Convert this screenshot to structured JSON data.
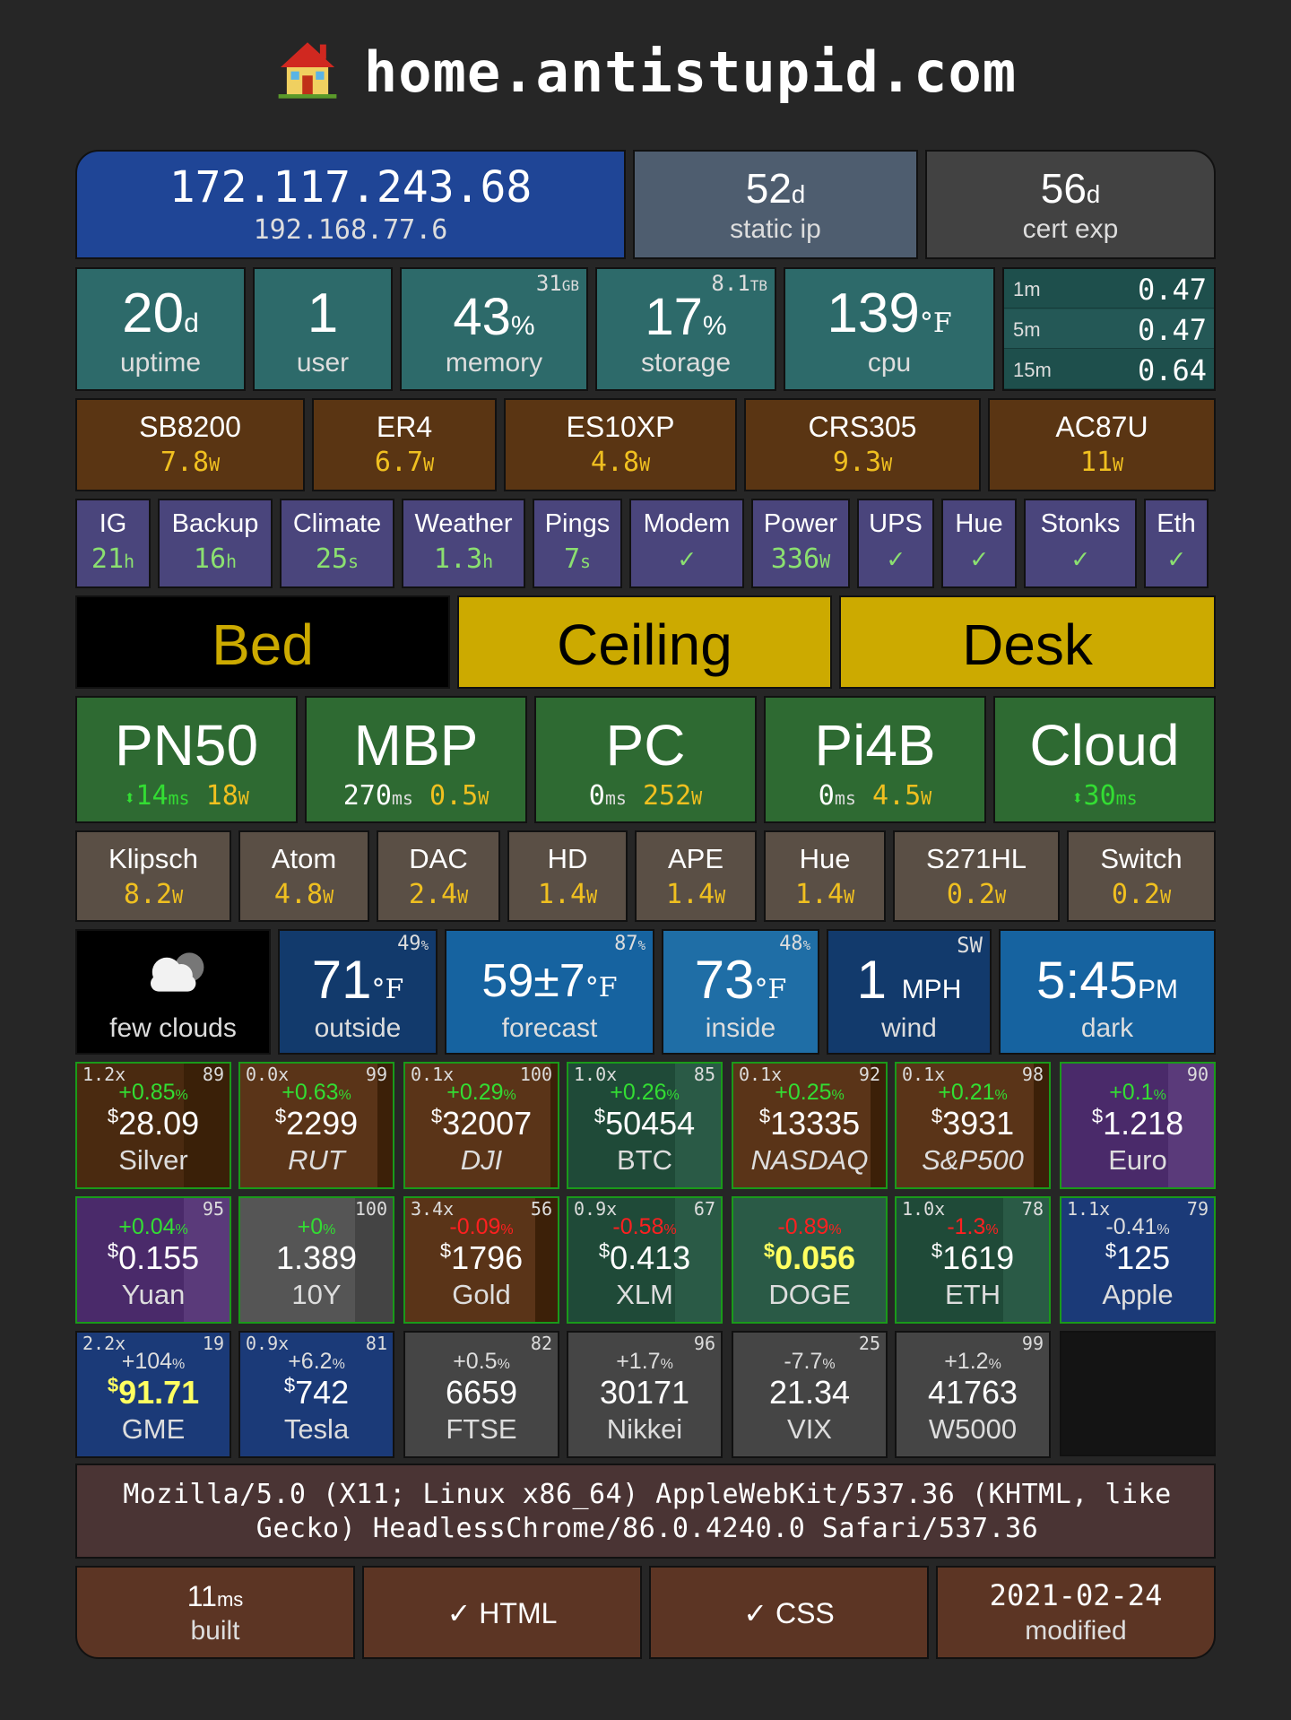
{
  "header": {
    "title": "home.antistupid.com",
    "icon": "house-icon"
  },
  "network": {
    "public_ip": "172.117.243.68",
    "local_ip": "192.168.77.6",
    "static_ip": {
      "value": "52",
      "unit": "d",
      "label": "static ip"
    },
    "cert": {
      "value": "56",
      "unit": "d",
      "label": "cert exp"
    }
  },
  "system": {
    "uptime": {
      "value": "20",
      "unit": "d",
      "label": "uptime"
    },
    "users": {
      "value": "1",
      "label": "user"
    },
    "memory": {
      "value": "43",
      "unit": "%",
      "label": "memory",
      "total": "31",
      "total_unit": "GB"
    },
    "storage": {
      "value": "17",
      "unit": "%",
      "label": "storage",
      "total": "8.1",
      "total_unit": "TB"
    },
    "cpu": {
      "value": "139",
      "unit": "°F",
      "label": "cpu"
    },
    "load": [
      {
        "period": "1m",
        "value": "0.47"
      },
      {
        "period": "5m",
        "value": "0.47"
      },
      {
        "period": "15m",
        "value": "0.64"
      }
    ]
  },
  "devices_power": [
    {
      "name": "SB8200",
      "value": "7.8",
      "unit": "W"
    },
    {
      "name": "ER4",
      "value": "6.7",
      "unit": "W"
    },
    {
      "name": "ES10XP",
      "value": "4.8",
      "unit": "W"
    },
    {
      "name": "CRS305",
      "value": "9.3",
      "unit": "W"
    },
    {
      "name": "AC87U",
      "value": "11",
      "unit": "W"
    }
  ],
  "services": [
    {
      "name": "IG",
      "value": "21",
      "unit": "h"
    },
    {
      "name": "Backup",
      "value": "16",
      "unit": "h"
    },
    {
      "name": "Climate",
      "value": "25",
      "unit": "s"
    },
    {
      "name": "Weather",
      "value": "1.3",
      "unit": "h"
    },
    {
      "name": "Pings",
      "value": "7",
      "unit": "s"
    },
    {
      "name": "Modem",
      "value": "✓",
      "unit": ""
    },
    {
      "name": "Power",
      "value": "336",
      "unit": "W"
    },
    {
      "name": "UPS",
      "value": "✓",
      "unit": ""
    },
    {
      "name": "Hue",
      "value": "✓",
      "unit": ""
    },
    {
      "name": "Stonks",
      "value": "✓",
      "unit": ""
    },
    {
      "name": "Eth",
      "value": "✓",
      "unit": ""
    }
  ],
  "lights": [
    {
      "name": "Bed",
      "state": "off"
    },
    {
      "name": "Ceiling",
      "state": "on"
    },
    {
      "name": "Desk",
      "state": "on"
    }
  ],
  "hosts": [
    {
      "name": "PN50",
      "arrow": "⬍",
      "ping": "14",
      "ping_unit": "ms",
      "power": "18",
      "power_unit": "W"
    },
    {
      "name": "MBP",
      "arrow": "",
      "ping": "270",
      "ping_unit": "ms",
      "power": "0.5",
      "power_unit": "W"
    },
    {
      "name": "PC",
      "arrow": "",
      "ping": "0",
      "ping_unit": "ms",
      "power": "252",
      "power_unit": "W"
    },
    {
      "name": "Pi4B",
      "arrow": "",
      "ping": "0",
      "ping_unit": "ms",
      "power": "4.5",
      "power_unit": "W"
    },
    {
      "name": "Cloud",
      "arrow": "⬍",
      "ping": "30",
      "ping_unit": "ms",
      "power": "",
      "power_unit": ""
    }
  ],
  "outlets": [
    {
      "name": "Klipsch",
      "value": "8.2",
      "unit": "W"
    },
    {
      "name": "Atom",
      "value": "4.8",
      "unit": "W"
    },
    {
      "name": "DAC",
      "value": "2.4",
      "unit": "W"
    },
    {
      "name": "HD",
      "value": "1.4",
      "unit": "W"
    },
    {
      "name": "APE",
      "value": "1.4",
      "unit": "W"
    },
    {
      "name": "Hue",
      "value": "1.4",
      "unit": "W"
    },
    {
      "name": "S271HL",
      "value": "0.2",
      "unit": "W"
    },
    {
      "name": "Switch",
      "value": "0.2",
      "unit": "W"
    }
  ],
  "weather": {
    "condition": "few clouds",
    "icon": "cloud-icon",
    "outside": {
      "value": "71",
      "unit": "°F",
      "label": "outside",
      "humidity": "49",
      "humidity_unit": "%"
    },
    "forecast": {
      "value": "59±7",
      "unit": "°F",
      "label": "forecast",
      "humidity": "87",
      "humidity_unit": "%"
    },
    "inside": {
      "value": "73",
      "unit": "°F",
      "label": "inside",
      "humidity": "48",
      "humidity_unit": "%"
    },
    "wind": {
      "value": "1",
      "unit": "MPH",
      "label": "wind",
      "direction": "SW"
    },
    "time": {
      "value": "5:45",
      "unit": "PM",
      "label": "dark"
    }
  },
  "stocks": [
    {
      "mult": "1.2x",
      "rank": "89",
      "change": "+0.85",
      "currency": "$",
      "price": "28.09",
      "name": "Silver",
      "italic": false,
      "dir": "up",
      "bg": "#4a2a10",
      "bar": "#3a2008",
      "bar_frac": 0.3
    },
    {
      "mult": "0.0x",
      "rank": "99",
      "change": "+0.63",
      "currency": "$",
      "price": "2299",
      "name": "RUT",
      "italic": true,
      "dir": "up",
      "bg": "#5a3418",
      "bar": "#3c2008",
      "bar_frac": 0.1
    },
    {
      "mult": "0.1x",
      "rank": "100",
      "change": "+0.29",
      "currency": "$",
      "price": "32007",
      "name": "DJI",
      "italic": true,
      "dir": "up",
      "bg": "#5a3418",
      "bar": "#3c2008",
      "bar_frac": 0.05
    },
    {
      "mult": "1.0x",
      "rank": "85",
      "change": "+0.26",
      "currency": "$",
      "price": "50454",
      "name": "BTC",
      "italic": false,
      "dir": "up",
      "bg": "#1f4a38",
      "bar": "#2a5a46",
      "bar_frac": 0.3
    },
    {
      "mult": "0.1x",
      "rank": "92",
      "change": "+0.25",
      "currency": "$",
      "price": "13335",
      "name": "NASDAQ",
      "italic": true,
      "dir": "up",
      "bg": "#5a3418",
      "bar": "#3c2008",
      "bar_frac": 0.1
    },
    {
      "mult": "0.1x",
      "rank": "98",
      "change": "+0.21",
      "currency": "$",
      "price": "3931",
      "name": "S&P500",
      "italic": true,
      "dir": "up",
      "bg": "#5a3418",
      "bar": "#3c2008",
      "bar_frac": 0.1
    },
    {
      "mult": "",
      "rank": "90",
      "change": "+0.1",
      "currency": "$",
      "price": "1.218",
      "name": "Euro",
      "italic": false,
      "dir": "up",
      "bg": "#4a2a6a",
      "bar": "#5a3a7a",
      "bar_frac": 0.3
    },
    {
      "mult": "",
      "rank": "95",
      "change": "+0.04",
      "currency": "$",
      "price": "0.155",
      "name": "Yuan",
      "italic": false,
      "dir": "up",
      "bg": "#4a2a6a",
      "bar": "#5a3a7a",
      "bar_frac": 0.3
    },
    {
      "mult": "",
      "rank": "100",
      "change": "+0",
      "currency": "",
      "price": "1.389",
      "name": "10Y",
      "italic": false,
      "dir": "up",
      "bg": "#555",
      "bar": "#444",
      "bar_frac": 0.25
    },
    {
      "mult": "3.4x",
      "rank": "56",
      "change": "-0.09",
      "currency": "$",
      "price": "1796",
      "name": "Gold",
      "italic": false,
      "dir": "down",
      "bg": "#5a3418",
      "bar": "#3c2008",
      "bar_frac": 0.15
    },
    {
      "mult": "0.9x",
      "rank": "67",
      "change": "-0.58",
      "currency": "$",
      "price": "0.413",
      "name": "XLM",
      "italic": false,
      "dir": "down",
      "bg": "#1f4a38",
      "bar": "#2a5a46",
      "bar_frac": 0.3
    },
    {
      "mult": "",
      "rank": "",
      "change": "-0.89",
      "currency": "$",
      "price": "0.056",
      "name": "DOGE",
      "italic": false,
      "dir": "down",
      "bg": "#2a5a46",
      "bar": "#2a5a46",
      "bar_frac": 0.0,
      "highlight": true
    },
    {
      "mult": "1.0x",
      "rank": "78",
      "change": "-1.3",
      "currency": "$",
      "price": "1619",
      "name": "ETH",
      "italic": false,
      "dir": "down",
      "bg": "#1f4a38",
      "bar": "#2a5a46",
      "bar_frac": 0.3
    },
    {
      "mult": "1.1x",
      "rank": "79",
      "change": "-0.41",
      "currency": "$",
      "price": "125",
      "name": "Apple",
      "italic": false,
      "dir": "flat",
      "bg": "#1b3a78",
      "bar": "#1b3a78",
      "bar_frac": 0.0
    },
    {
      "mult": "2.2x",
      "rank": "19",
      "change": "+104",
      "currency": "$",
      "price": "91.71",
      "name": "GME",
      "italic": false,
      "dir": "flat",
      "bg": "#1b3a78",
      "bar": "#1b3a78",
      "bar_frac": 0.0,
      "highlight": true,
      "nogreen": true
    },
    {
      "mult": "0.9x",
      "rank": "81",
      "change": "+6.2",
      "currency": "$",
      "price": "742",
      "name": "Tesla",
      "italic": false,
      "dir": "flat",
      "bg": "#1b3a78",
      "bar": "#1b3a78",
      "bar_frac": 0.0,
      "nogreen": true
    },
    {
      "mult": "",
      "rank": "82",
      "change": "+0.5",
      "currency": "",
      "price": "6659",
      "name": "FTSE",
      "italic": false,
      "dir": "flat",
      "bg": "#454545",
      "bar": "#454545",
      "bar_frac": 0.0,
      "nogreen": true
    },
    {
      "mult": "",
      "rank": "96",
      "change": "+1.7",
      "currency": "",
      "price": "30171",
      "name": "Nikkei",
      "italic": false,
      "dir": "flat",
      "bg": "#454545",
      "bar": "#454545",
      "bar_frac": 0.0,
      "nogreen": true
    },
    {
      "mult": "",
      "rank": "25",
      "change": "-7.7",
      "currency": "",
      "price": "21.34",
      "name": "VIX",
      "italic": false,
      "dir": "flat",
      "bg": "#454545",
      "bar": "#454545",
      "bar_frac": 0.0,
      "nogreen": true
    },
    {
      "mult": "",
      "rank": "99",
      "change": "+1.2",
      "currency": "",
      "price": "41763",
      "name": "W5000",
      "italic": false,
      "dir": "flat",
      "bg": "#454545",
      "bar": "#454545",
      "bar_frac": 0.0,
      "nogreen": true
    }
  ],
  "user_agent": "Mozilla/5.0 (X11; Linux x86_64) AppleWebKit/537.36 (KHTML, like Gecko) HeadlessChrome/86.0.4240.0 Safari/537.36",
  "footer": {
    "built": {
      "value": "11",
      "unit": "ms",
      "label": "built"
    },
    "html": "✓ HTML",
    "css": "✓ CSS",
    "modified": {
      "value": "2021-02-24",
      "label": "modified"
    }
  },
  "colors": {
    "background": "#262626",
    "amber": "#f0c020",
    "green_text": "#8be070",
    "up": "#33dd33",
    "down": "#ff2020"
  }
}
